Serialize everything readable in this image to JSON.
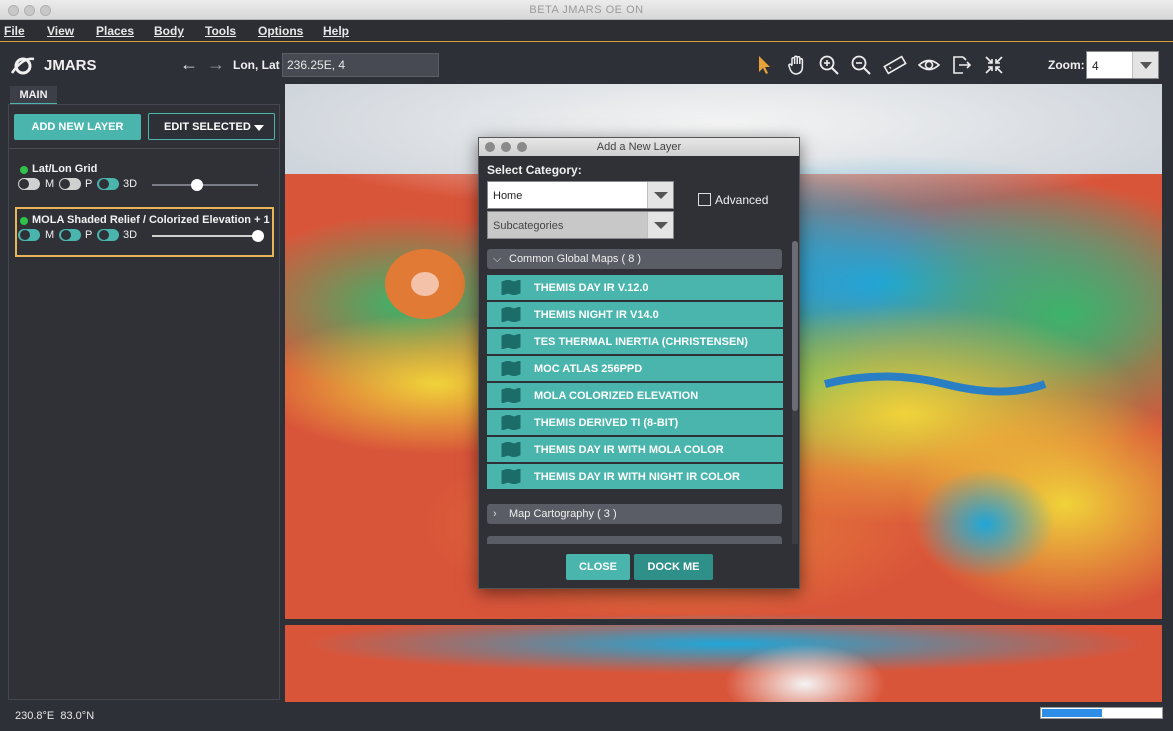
{
  "window": {
    "title": "BETA JMARS OE ON"
  },
  "menu": [
    "File",
    "View",
    "Places",
    "Body",
    "Tools",
    "Options",
    "Help"
  ],
  "toolbar": {
    "app_name": "JMARS",
    "lonlat_label": "Lon, Lat",
    "lonlat_value": "236.25E, 4",
    "zoom_label": "Zoom:",
    "zoom_value": "4",
    "tools": [
      "select-arrow-icon",
      "pan-hand-icon",
      "zoom-in-icon",
      "zoom-out-icon",
      "ruler-icon",
      "eye-icon",
      "export-icon",
      "collapse-icon"
    ]
  },
  "left_panel": {
    "tab": "MAIN",
    "add_layer_label": "ADD NEW LAYER",
    "edit_selected_label": "EDIT SELECTED",
    "layers": [
      {
        "name": "Lat/Lon Grid",
        "toggles": [
          "M",
          "P",
          "3D"
        ],
        "toggle_states": [
          false,
          false,
          true
        ],
        "opacity": 0.5
      },
      {
        "name": "MOLA Shaded Relief / Colorized Elevation + 1",
        "toggles": [
          "M",
          "P",
          "3D"
        ],
        "toggle_states": [
          true,
          true,
          true
        ],
        "opacity": 1.0,
        "selected": true
      }
    ]
  },
  "dialog": {
    "title": "Add a New Layer",
    "category_label": "Select Category:",
    "category_value": "Home",
    "subcategory_value": "Subcategories",
    "advanced_label": "Advanced",
    "groups": [
      {
        "label": "Common Global Maps",
        "count": "( 8 )",
        "expanded": true
      },
      {
        "label": "Map Cartography",
        "count": "( 3 )",
        "expanded": false
      }
    ],
    "maps": [
      "THEMIS DAY IR V.12.0",
      "THEMIS NIGHT IR V14.0",
      "TES THERMAL INERTIA (CHRISTENSEN)",
      "MOC ATLAS 256PPD",
      "MOLA COLORIZED ELEVATION",
      "THEMIS DERIVED TI (8-BIT)",
      "THEMIS DAY IR WITH MOLA COLOR",
      "THEMIS DAY IR WITH NIGHT IR COLOR"
    ],
    "close_label": "CLOSE",
    "dock_label": "DOCK ME"
  },
  "status": {
    "lon": "230.8°E",
    "lat": "83.0°N",
    "progress": 0.5
  },
  "colors": {
    "accent": "#4ab5ad",
    "highlight": "#e8b55a",
    "progress": "#2e8de6"
  }
}
